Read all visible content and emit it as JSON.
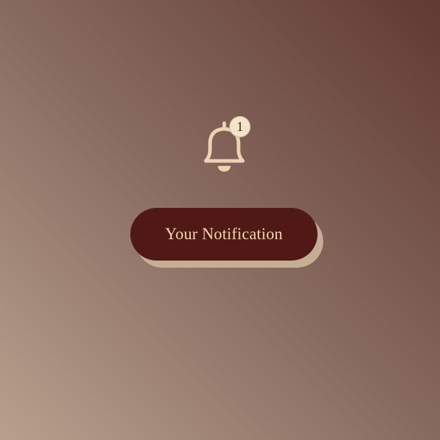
{
  "notification": {
    "badge_count": "1",
    "button_label": "Your Notification",
    "icon": "bell-icon"
  },
  "colors": {
    "background_dark": "#613a31",
    "background_light": "#b8a08e",
    "button_bg": "#501915",
    "button_text": "#f0d6b2",
    "button_shadow": "#c5ae95",
    "icon_stroke": "#ecd3b3",
    "badge_bg": "#f6e2c6"
  }
}
